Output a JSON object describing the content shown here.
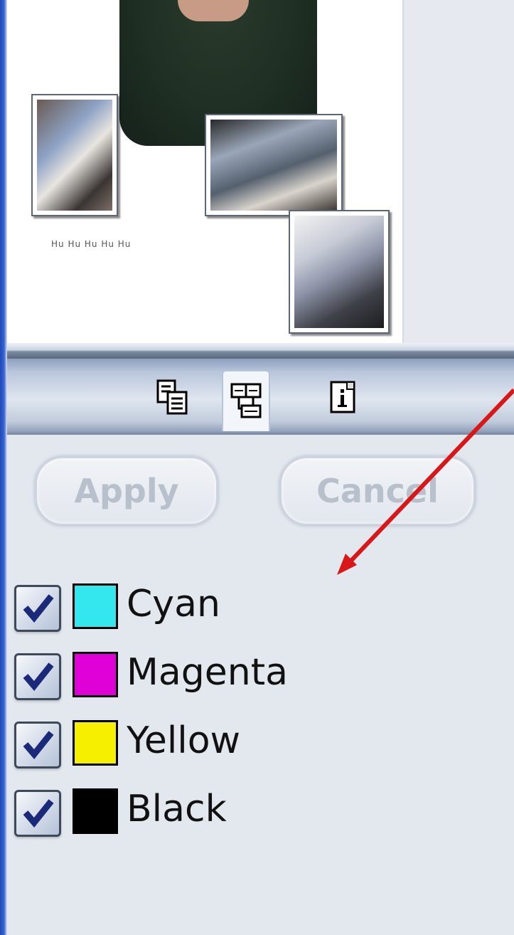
{
  "preview": {
    "caption": "Hu Hu Hu Hu Hu"
  },
  "tabs": [
    {
      "name": "document-pages-icon",
      "active": false
    },
    {
      "name": "separations-icon",
      "active": true
    },
    {
      "name": "info-icon",
      "active": false
    }
  ],
  "buttons": {
    "apply_label": "Apply",
    "cancel_label": "Cancel"
  },
  "channels": [
    {
      "label": "Cyan",
      "color": "#34e6ee",
      "checked": true
    },
    {
      "label": "Magenta",
      "color": "#e000d8",
      "checked": true
    },
    {
      "label": "Yellow",
      "color": "#f7ef00",
      "checked": true
    },
    {
      "label": "Black",
      "color": "#000000",
      "checked": true
    }
  ],
  "colors": {
    "frame_blue": "#2f58c8",
    "panel_bg": "#e3e8ef",
    "annotation_arrow": "#d81818"
  }
}
